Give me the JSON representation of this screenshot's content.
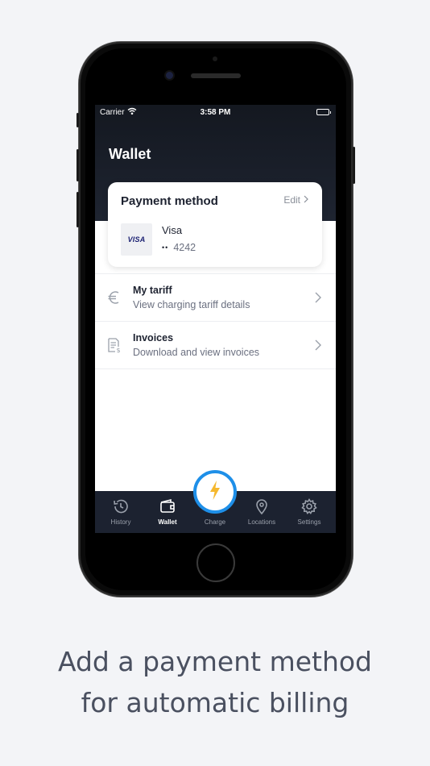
{
  "status_bar": {
    "carrier": "Carrier",
    "time": "3:58 PM"
  },
  "header": {
    "title": "Wallet"
  },
  "payment_card": {
    "title": "Payment method",
    "edit_label": "Edit",
    "card_logo": "VISA",
    "card_brand": "Visa",
    "card_mask": "••",
    "card_last4": "4242"
  },
  "rows": [
    {
      "icon": "euro-icon",
      "title": "My tariff",
      "subtitle": "View charging tariff details"
    },
    {
      "icon": "invoice-icon",
      "title": "Invoices",
      "subtitle": "Download and view invoices"
    }
  ],
  "tabs": [
    {
      "icon": "history-icon",
      "label": "History",
      "active": false
    },
    {
      "icon": "wallet-icon",
      "label": "Wallet",
      "active": true
    },
    {
      "icon": "lightning-icon",
      "label": "Charge",
      "active": false
    },
    {
      "icon": "location-pin-icon",
      "label": "Locations",
      "active": false
    },
    {
      "icon": "gear-icon",
      "label": "Settings",
      "active": false
    }
  ],
  "caption": {
    "line1": "Add a payment method",
    "line2": "for automatic billing"
  },
  "colors": {
    "header_bg": "#1e2431",
    "tab_bar_bg": "#1c2230",
    "charge_ring": "#1e8fe8",
    "charge_bolt": "#f5b82e",
    "background": "#f3f4f7"
  }
}
